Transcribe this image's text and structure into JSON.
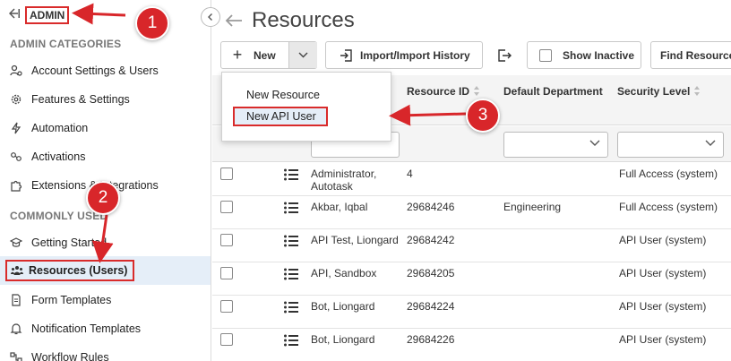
{
  "sidebar": {
    "admin_label": "ADMIN",
    "section_admin": "ADMIN CATEGORIES",
    "section_common": "COMMONLY USED",
    "admin_items": [
      {
        "label": "Account Settings & Users",
        "icon": "user-gear-icon"
      },
      {
        "label": "Features & Settings",
        "icon": "gear-icon"
      },
      {
        "label": "Automation",
        "icon": "bolt-icon"
      },
      {
        "label": "Activations",
        "icon": "activations-icon"
      },
      {
        "label": "Extensions & Integrations",
        "icon": "puzzle-icon"
      }
    ],
    "common_items": [
      {
        "label": "Getting Started",
        "icon": "graduation-cap-icon"
      },
      {
        "label": "Resources (Users)",
        "icon": "users-icon",
        "active": true
      },
      {
        "label": "Form Templates",
        "icon": "document-icon"
      },
      {
        "label": "Notification Templates",
        "icon": "bell-icon"
      },
      {
        "label": "Workflow Rules",
        "icon": "flow-icon"
      }
    ]
  },
  "main": {
    "title": "Resources",
    "toolbar": {
      "new_label": "New",
      "import_label": "Import/Import History",
      "show_inactive_label": "Show Inactive",
      "find_label": "Find Resource"
    },
    "new_menu": {
      "items": [
        "New Resource",
        "New API User"
      ]
    },
    "columns": [
      "Resource ID",
      "Default Department",
      "Security Level"
    ],
    "rows": [
      {
        "name": "Administrator, Autotask",
        "id": "4",
        "dept": "",
        "security": "Full Access (system)"
      },
      {
        "name": "Akbar, Iqbal",
        "id": "29684246",
        "dept": "Engineering",
        "security": "Full Access (system)"
      },
      {
        "name": "API Test, Liongard",
        "id": "29684242",
        "dept": "",
        "security": "API User (system)"
      },
      {
        "name": "API, Sandbox",
        "id": "29684205",
        "dept": "",
        "security": "API User (system)"
      },
      {
        "name": "Bot, Liongard",
        "id": "29684224",
        "dept": "",
        "security": "API User (system)"
      },
      {
        "name": "Bot, Liongard",
        "id": "29684226",
        "dept": "",
        "security": "API User (system)"
      }
    ]
  },
  "callouts": [
    "1",
    "2",
    "3"
  ],
  "colors": {
    "annotation_red": "#d8262a",
    "active_bg": "#e5eef8",
    "header_bg": "#f4f4f4"
  }
}
